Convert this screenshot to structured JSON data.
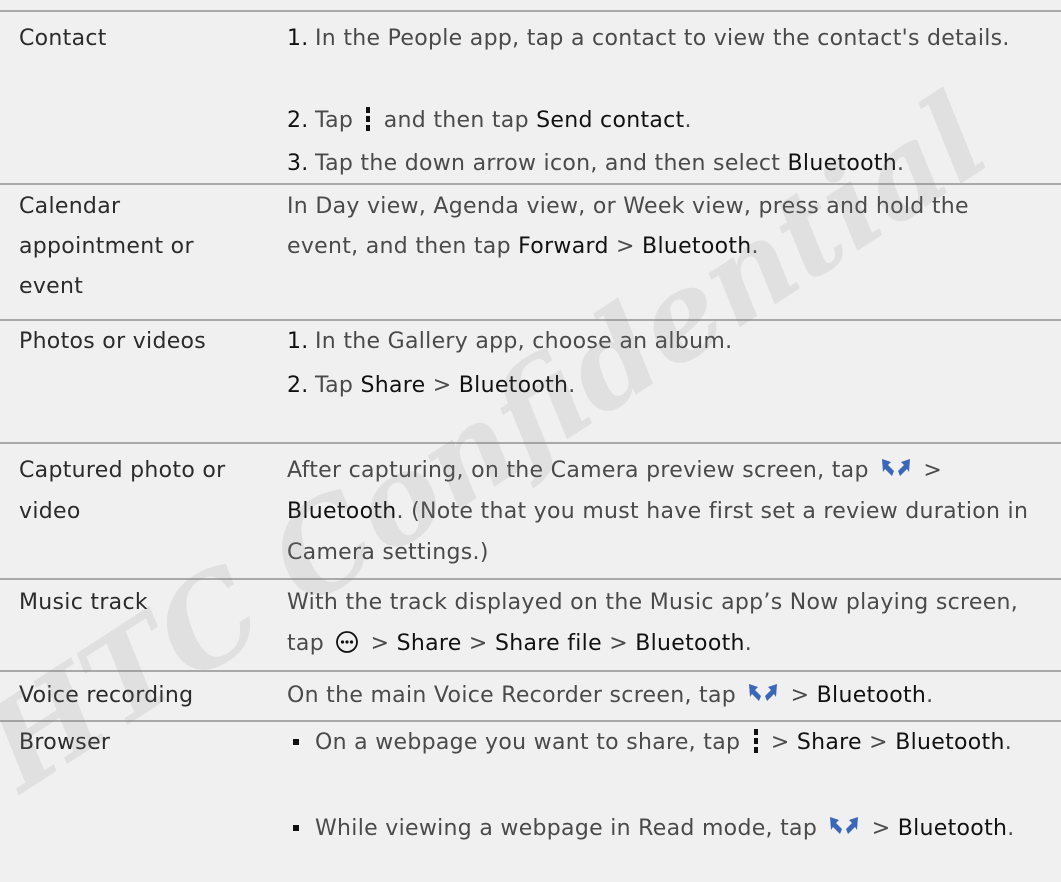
{
  "watermark": "HTC Confidential",
  "colors": {
    "row_background": "#f0f0f0",
    "row_divider": "#a9a9a9",
    "text": "#4a4a4a",
    "emphasis": "#111111"
  },
  "rows": {
    "contact": {
      "label": "Contact",
      "step1_num": "1.",
      "step1_text": "In the People app, tap a contact to view the contact's details.",
      "step2_num": "2.",
      "step2_pre": "Tap",
      "step2_mid": "and then tap",
      "step2_bold": "Send contact",
      "step2_post": ".",
      "step3_num": "3.",
      "step3_pre": "Tap the down arrow icon, and then select",
      "step3_bold": "Bluetooth",
      "step3_post": ".",
      "icon": "menu-kebab-icon"
    },
    "calendar": {
      "label_line1": "Calendar",
      "label_line2": "appointment or",
      "label_line3": "event",
      "pre": "In Day view, Agenda view, or Week view, press and hold the event, and then tap",
      "bold1": "Forward",
      "sep": ">",
      "bold2": "Bluetooth",
      "post": "."
    },
    "photos": {
      "label": "Photos or videos",
      "step1_num": "1.",
      "step1_text": "In the Gallery app, choose an album.",
      "step2_num": "2.",
      "step2_pre": "Tap",
      "step2_bold1": "Share",
      "step2_sep": ">",
      "step2_bold2": "Bluetooth",
      "step2_post": "."
    },
    "captured": {
      "label_line1": "Captured photo or",
      "label_line2": "video",
      "pre": "After capturing, on the Camera preview screen, tap",
      "sep": ">",
      "bold": "Bluetooth",
      "post": ". (Note that you must have first set a review duration in Camera settings.)",
      "icon": "share-icon"
    },
    "music": {
      "label": "Music track",
      "pre": "With the track displayed on the Music app’s Now playing screen, tap",
      "sep1": ">",
      "bold1": "Share",
      "sep2": ">",
      "bold2": "Share file",
      "sep3": ">",
      "bold3": "Bluetooth",
      "post": ".",
      "icon": "more-options-icon"
    },
    "voice": {
      "label": "Voice recording",
      "pre": "On the main Voice Recorder screen, tap",
      "sep": ">",
      "bold": "Bluetooth",
      "post": ".",
      "icon": "share-icon"
    },
    "browser": {
      "label": "Browser",
      "b1_pre": "On a webpage you want to share, tap",
      "b1_sep1": ">",
      "b1_bold1": "Share",
      "b1_sep2": ">",
      "b1_bold2": "Bluetooth",
      "b1_post": ".",
      "b2_pre": "While viewing a webpage in Read mode, tap",
      "b2_sep": ">",
      "b2_bold": "Bluetooth",
      "b2_post": ".",
      "icon1": "menu-kebab-icon",
      "icon2": "share-icon"
    }
  }
}
